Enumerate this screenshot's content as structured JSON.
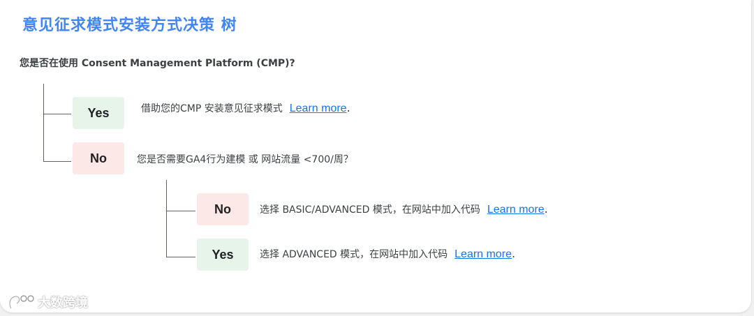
{
  "title": "意见征求模式安装方式决策 树",
  "question": "您是否在使用 Consent Management Platform (CMP)?",
  "branch_yes": {
    "label": "Yes",
    "text": "借助您的CMP 安装意见征求模式",
    "link": "Learn more",
    "period": "."
  },
  "branch_no": {
    "label": "No",
    "text": "您是否需要GA4行为建模 或 网站流量 <700/周？"
  },
  "sub_no": {
    "label": "No",
    "text": "选择 BASIC/ADVANCED 模式，在网站中加入代码",
    "link": "Learn more",
    "period": "."
  },
  "sub_yes": {
    "label": "Yes",
    "text": "选择 ADVANCED 模式，在网站中加入代码",
    "link": "Learn more",
    "period": "."
  },
  "watermark": "大数跨境",
  "colors": {
    "title": "#4285f4",
    "link": "#1a73e8",
    "yes_bg": "#e6f4ea",
    "no_bg": "#fce8e6"
  }
}
